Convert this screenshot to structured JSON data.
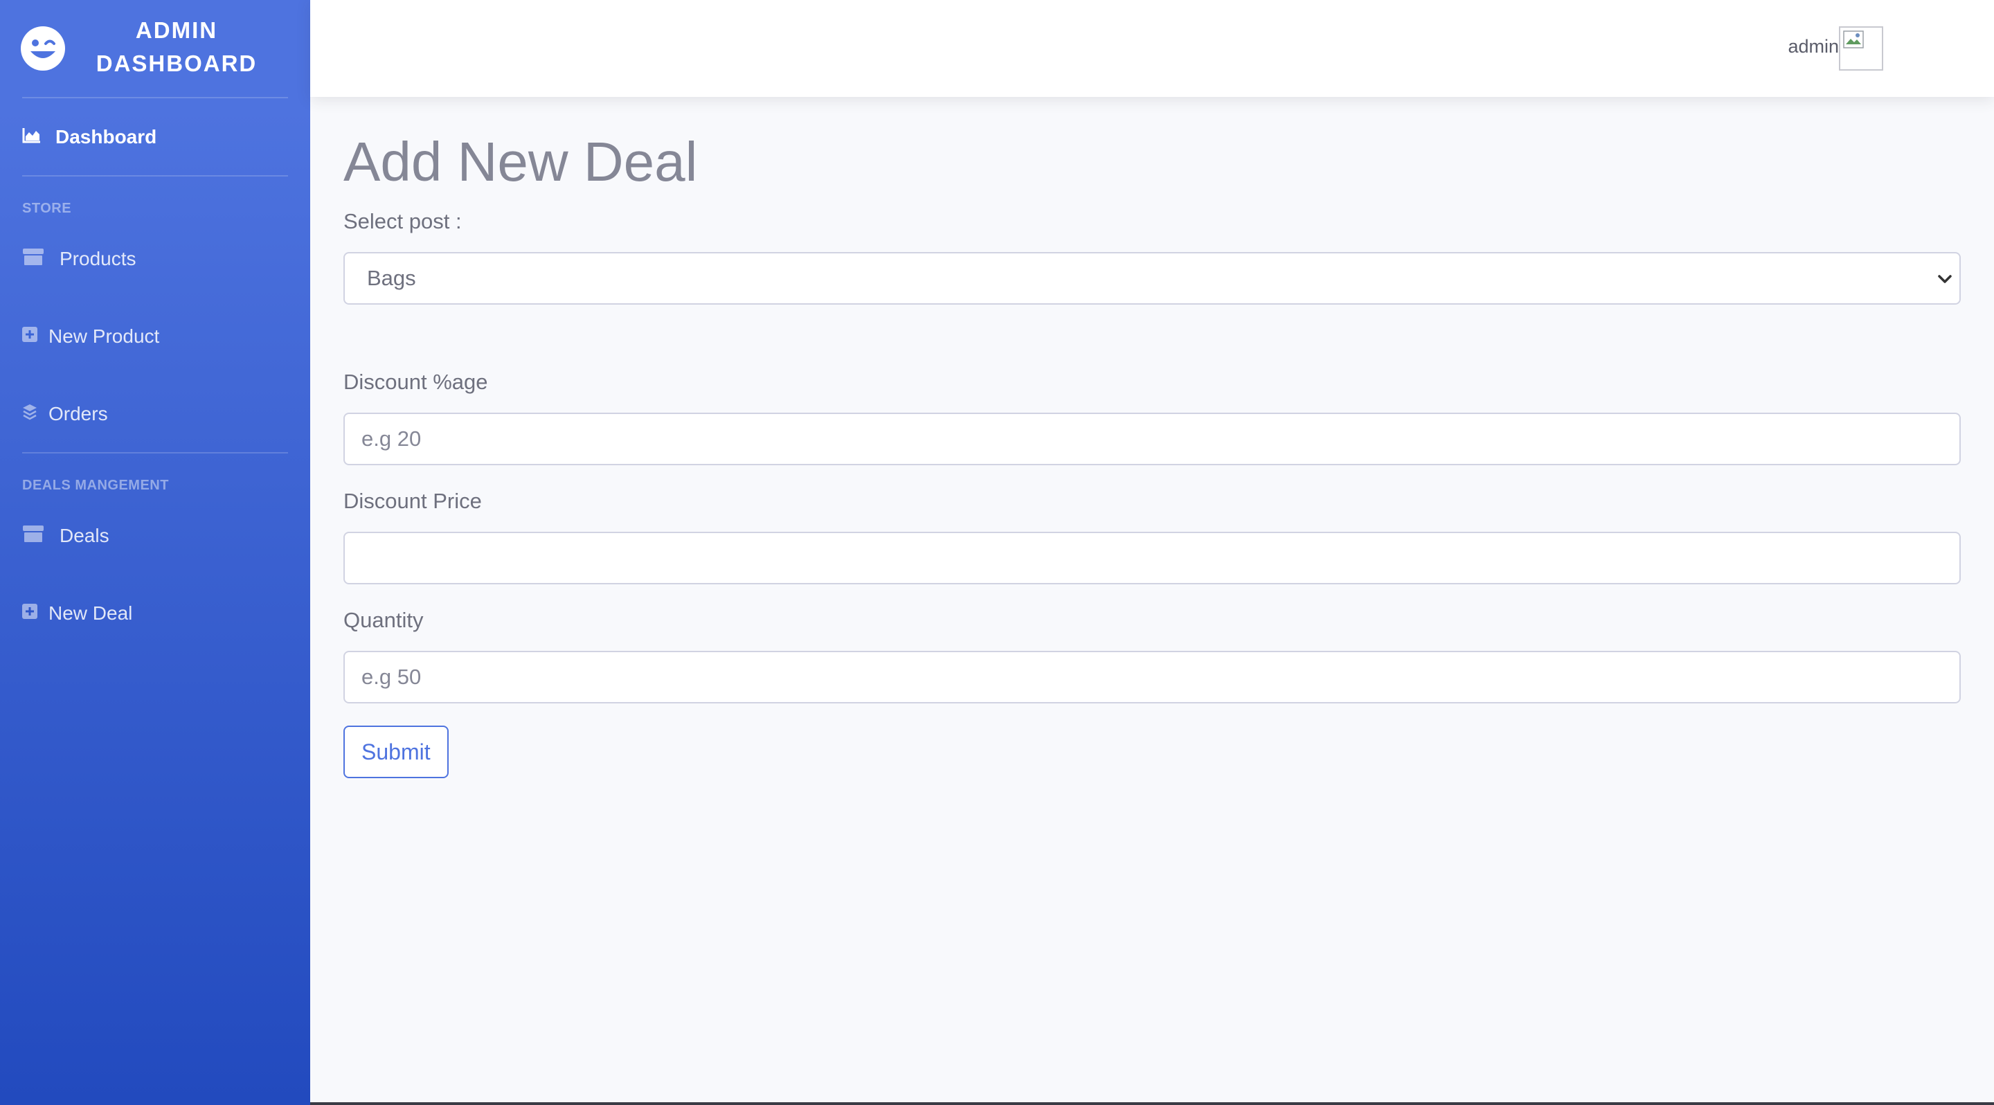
{
  "brand": {
    "line1": "ADMIN",
    "line2": "DASHBOARD",
    "icon": "laugh-wink-icon"
  },
  "sidebar": {
    "dashboard": {
      "label": "Dashboard",
      "icon": "chart-area-icon"
    },
    "store_heading": "STORE",
    "store_items": [
      {
        "label": "Products",
        "icon": "store-icon"
      },
      {
        "label": "New Product",
        "icon": "plus-square-icon"
      },
      {
        "label": "Orders",
        "icon": "layer-group-icon"
      }
    ],
    "deals_heading": "DEALS MANGEMENT",
    "deals_items": [
      {
        "label": "Deals",
        "icon": "store-icon"
      },
      {
        "label": "New Deal",
        "icon": "plus-square-icon"
      }
    ]
  },
  "topbar": {
    "user_name": "admin",
    "avatar_icon": "broken-image-icon"
  },
  "page": {
    "title": "Add New Deal"
  },
  "form": {
    "post_label": "Select post :",
    "post_selected": "Bags",
    "discount_percent_label": "Discount %age",
    "discount_percent_placeholder": "e.g 20",
    "discount_price_label": "Discount Price",
    "discount_price_placeholder": "",
    "quantity_label": "Quantity",
    "quantity_placeholder": "e.g 50",
    "submit_label": "Submit"
  },
  "colors": {
    "sidebar_top": "#4e73df",
    "sidebar_bottom": "#224abe",
    "primary": "#4e73df",
    "background": "#f8f9fc",
    "text_muted": "#858796"
  }
}
